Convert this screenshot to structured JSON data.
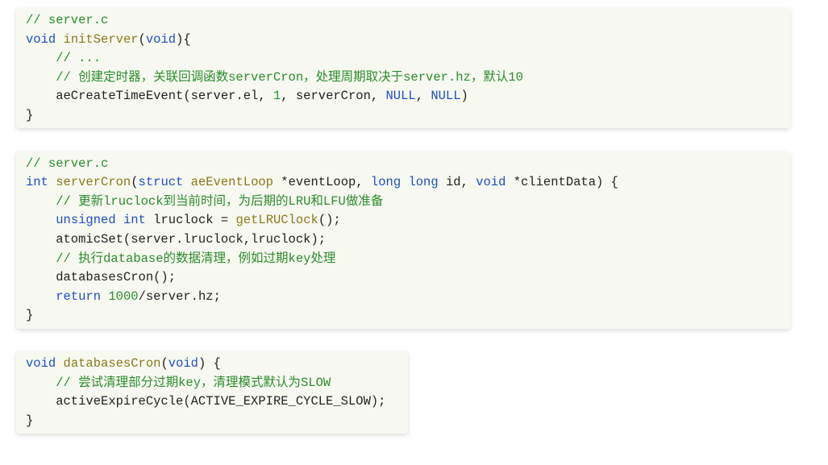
{
  "blocks": [
    {
      "c1": "// server.c",
      "l2_kw1": "void",
      "l2_fn": "initServer",
      "l2_kw2": "void",
      "l2_tail": "){",
      "l3": "    // ...",
      "l4": "    // 创建定时器，关联回调函数serverCron，处理周期取决于server.hz，默认10",
      "l5_a": "    aeCreateTimeEvent(server.el, ",
      "l5_num": "1",
      "l5_b": ", serverCron, ",
      "l5_n1": "NULL",
      "l5_c": ", ",
      "l5_n2": "NULL",
      "l5_d": ")",
      "l6": "}"
    },
    {
      "c1": "// server.c",
      "l2_kw1": "int",
      "l2_fn": "serverCron",
      "l2_p1": "(",
      "l2_kw2": "struct",
      "l2_ty": "aeEventLoop",
      "l2_p2": " *eventLoop, ",
      "l2_kw3": "long",
      "l2_kw4": "long",
      "l2_p3": " id, ",
      "l2_kw5": "void",
      "l2_p4": " *clientData) {",
      "l3": "    // 更新lruclock到当前时间，为后期的LRU和LFU做准备",
      "l4_kw1": "unsigned",
      "l4_kw2": "int",
      "l4_a": " lruclock = ",
      "l4_fn": "getLRUClock",
      "l4_b": "();",
      "l5": "    atomicSet(server.lruclock,lruclock);",
      "l6": "    // 执行database的数据清理，例如过期key处理",
      "l7": "    databasesCron();",
      "l8_kw": "return",
      "l8_num": "1000",
      "l8_tail": "/server.hz;",
      "l9": "}"
    },
    {
      "l1_kw1": "void",
      "l1_fn": "databasesCron",
      "l1_p1": "(",
      "l1_kw2": "void",
      "l1_p2": ") {",
      "l2": "    // 尝试清理部分过期key，清理模式默认为SLOW",
      "l3": "    activeExpireCycle(ACTIVE_EXPIRE_CYCLE_SLOW);",
      "l4": "}"
    }
  ]
}
